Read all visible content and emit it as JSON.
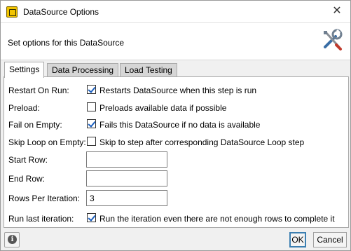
{
  "window": {
    "title": "DataSource Options",
    "close_glyph": "✕"
  },
  "header": {
    "text": "Set options for this DataSource",
    "icon": "tools-icon"
  },
  "tabs": [
    {
      "label": "Settings",
      "active": true
    },
    {
      "label": "Data Processing",
      "active": false
    },
    {
      "label": "Load Testing",
      "active": false
    }
  ],
  "settings": {
    "restart_on_run": {
      "label": "Restart On Run:",
      "checked": true,
      "text": "Restarts DataSource when this step is run"
    },
    "preload": {
      "label": "Preload:",
      "checked": false,
      "text": "Preloads available data if possible"
    },
    "fail_on_empty": {
      "label": "Fail on Empty:",
      "checked": true,
      "text": "Fails this DataSource if no data is available"
    },
    "skip_loop_on_empty": {
      "label": "Skip Loop on Empty:",
      "checked": false,
      "text": "Skip to step after corresponding DataSource Loop step"
    },
    "start_row": {
      "label": "Start Row:",
      "value": ""
    },
    "end_row": {
      "label": "End Row:",
      "value": ""
    },
    "rows_per_iteration": {
      "label": "Rows Per Iteration:",
      "value": "3"
    },
    "run_last_iteration": {
      "label": "Run last iteration:",
      "checked": true,
      "text": "Run the iteration even there are not enough rows to complete it"
    }
  },
  "footer": {
    "info_glyph": "i",
    "ok_label": "OK",
    "cancel_label": "Cancel"
  },
  "colors": {
    "checkmark": "#1b5fbf",
    "ok_border": "#3c7fb1",
    "tab_inactive": "#d6d6d6"
  }
}
